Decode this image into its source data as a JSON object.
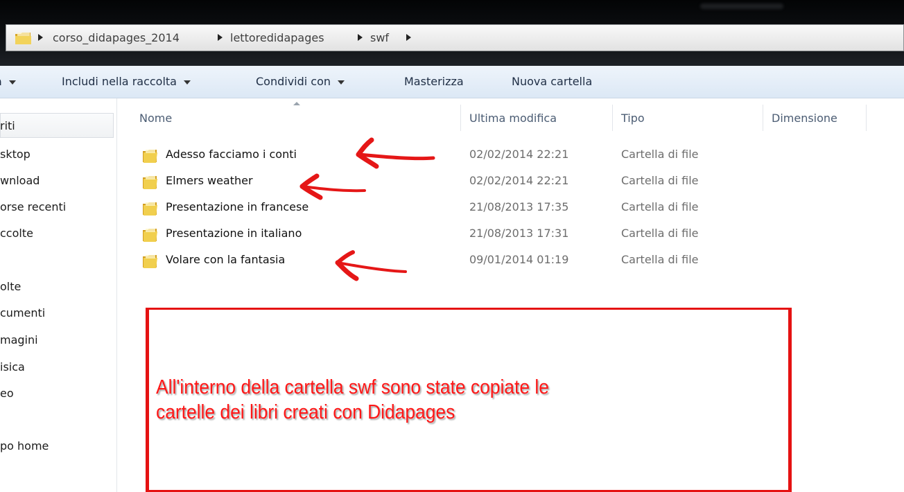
{
  "address_bar": {
    "crumbs": [
      "corso_didapages_2014",
      "lettoredidapages",
      "swf"
    ]
  },
  "toolbar": {
    "partial_left": "a",
    "include_library": "Includi nella raccolta",
    "share_with": "Condividi con",
    "burn": "Masterizza",
    "new_folder": "Nuova cartella"
  },
  "sidebar": {
    "items": [
      "riti",
      "sktop",
      "wnload",
      "orse recenti",
      "ccolte",
      "olte",
      "cumenti",
      "magini",
      "isica",
      "eo",
      "po home"
    ]
  },
  "columns": {
    "name": "Nome",
    "modified": "Ultima modifica",
    "type": "Tipo",
    "size": "Dimensione"
  },
  "files": [
    {
      "name": "Adesso facciamo i conti",
      "modified": "02/02/2014 22:21",
      "type": "Cartella di file",
      "annotated": true
    },
    {
      "name": "Elmers weather",
      "modified": "02/02/2014 22:21",
      "type": "Cartella di file",
      "annotated": true
    },
    {
      "name": "Presentazione in francese",
      "modified": "21/08/2013 17:35",
      "type": "Cartella di file",
      "annotated": false
    },
    {
      "name": "Presentazione in italiano",
      "modified": "21/08/2013 17:31",
      "type": "Cartella di file",
      "annotated": false
    },
    {
      "name": "Volare con la fantasia",
      "modified": "09/01/2014 01:19",
      "type": "Cartella di file",
      "annotated": true
    }
  ],
  "annotation": {
    "lines": [
      "All'interno della cartella swf sono state copiate le",
      "cartelle dei libri creati con Didapages"
    ],
    "color": "#ff1717"
  },
  "icons": {
    "folder": "folder-icon",
    "breadcrumb_separator": "chevron-right-icon",
    "dropdown": "chevron-down-icon",
    "annotation": "red-arrow-icon"
  }
}
